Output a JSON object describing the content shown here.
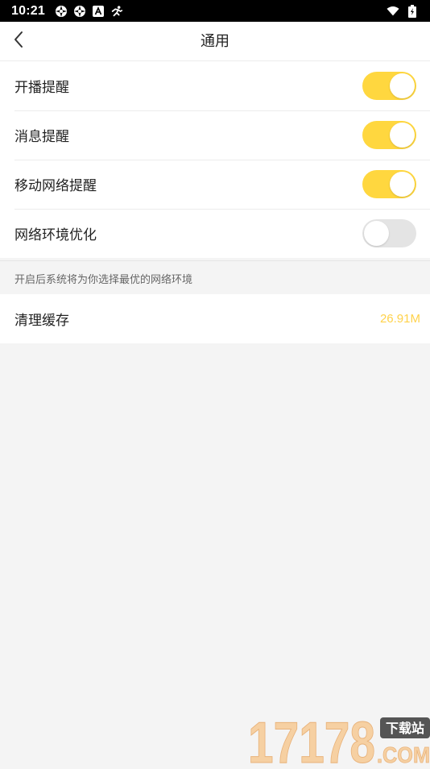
{
  "status_bar": {
    "time": "10:21",
    "left_icons": [
      "aperture-icon",
      "aperture-icon",
      "font-a-icon",
      "running-person-icon"
    ],
    "right_icons": [
      "wifi-icon",
      "battery-charging-icon"
    ]
  },
  "nav": {
    "back_icon": "chevron-left-icon",
    "title": "通用"
  },
  "settings": [
    {
      "label": "开播提醒",
      "toggle_on": true
    },
    {
      "label": "消息提醒",
      "toggle_on": true
    },
    {
      "label": "移动网络提醒",
      "toggle_on": true
    },
    {
      "label": "网络环境优化",
      "toggle_on": false
    }
  ],
  "hint": "开启后系统将为你选择最优的网络环境",
  "cache": {
    "label": "清理缓存",
    "value": "26.91M"
  },
  "colors": {
    "accent": "#ffd73f",
    "cache_value": "#ffd24a",
    "toggle_off": "#e4e4e4",
    "background": "#f4f4f4"
  },
  "watermark": {
    "number": "17178",
    "badge": "下载站",
    "suffix": ".COM"
  }
}
